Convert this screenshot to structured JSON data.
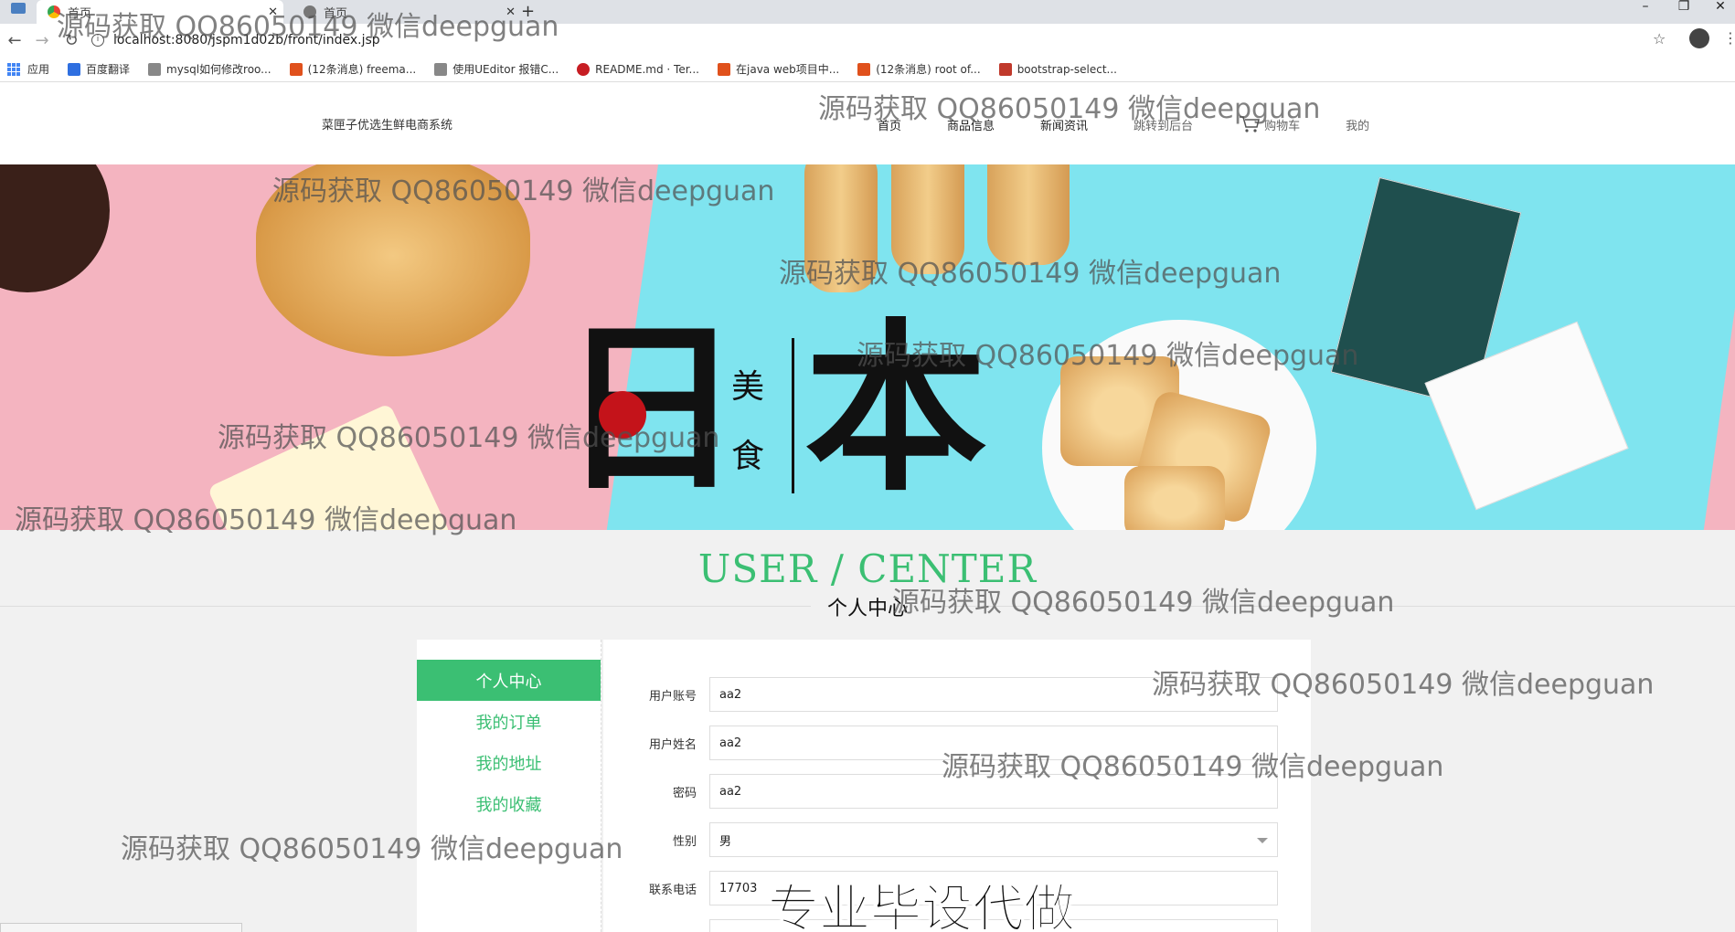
{
  "browser": {
    "tabs": [
      {
        "label": "首页"
      },
      {
        "label": "首页"
      }
    ],
    "new_tab": "+",
    "controls": {
      "minimize": "–",
      "restore": "❐",
      "close": "✕"
    },
    "url": "localhost:8080/jspm1d02b/front/index.jsp",
    "bookmarks": [
      {
        "label": "应用",
        "color": "#4285f4"
      },
      {
        "label": "百度翻译",
        "color": "#2f6fe0"
      },
      {
        "label": "mysql如何修改roo...",
        "color": "#555555"
      },
      {
        "label": "(12条消息) freema...",
        "color": "#e0511c"
      },
      {
        "label": "使用UEditor 报错C...",
        "color": "#555555"
      },
      {
        "label": "README.md · Ter...",
        "color": "#c71d23"
      },
      {
        "label": "在java web项目中...",
        "color": "#e0511c"
      },
      {
        "label": "(12条消息) root of...",
        "color": "#e0511c"
      },
      {
        "label": "bootstrap-select...",
        "color": "#c0392b"
      }
    ]
  },
  "header": {
    "brand": "菜匣子优选生鲜电商系统",
    "nav": [
      {
        "label": "首页"
      },
      {
        "label": "商品信息"
      },
      {
        "label": "新闻资讯"
      },
      {
        "label": "跳转到后台"
      },
      {
        "label": "购物车"
      },
      {
        "label": "我的"
      }
    ]
  },
  "banner": {
    "char_large_1": "日",
    "char_large_2": "本",
    "char_small_1": "美",
    "char_small_2": "食"
  },
  "section": {
    "title": "USER / CENTER",
    "subtitle": "个人中心"
  },
  "sidebar": {
    "items": [
      {
        "label": "个人中心"
      },
      {
        "label": "我的订单"
      },
      {
        "label": "我的地址"
      },
      {
        "label": "我的收藏"
      }
    ]
  },
  "form": {
    "fields": [
      {
        "label": "用户账号",
        "value": "aa2"
      },
      {
        "label": "用户姓名",
        "value": "aa2"
      },
      {
        "label": "密码",
        "value": "aa2"
      },
      {
        "label": "性别",
        "value": "男"
      },
      {
        "label": "联系电话",
        "value": "17703"
      }
    ]
  },
  "watermark": "源码获取 QQ86050149 微信deepguan",
  "promo": "专业毕设代做",
  "colors": {
    "accent": "#3bbf73",
    "banner_pink": "#f4b4c0",
    "banner_blue": "#7fe4ef"
  }
}
